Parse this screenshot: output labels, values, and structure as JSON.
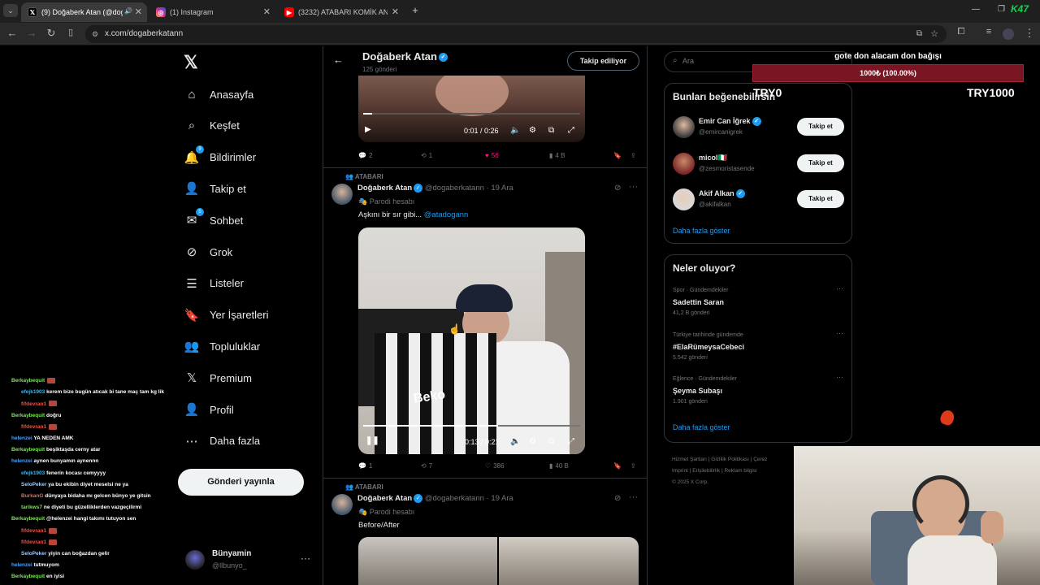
{
  "browser": {
    "tabs": [
      {
        "label": "(9) Doğaberk Atan (@dogaberkatann)",
        "icon": "x-logo-icon",
        "active": true
      },
      {
        "label": "(1) Instagram",
        "icon": "instagram-icon",
        "active": false
      },
      {
        "label": "(3232) ATABARI KOMİK ANLAR",
        "icon": "youtube-icon",
        "active": false
      }
    ],
    "url": "x.com/dogaberkatann"
  },
  "sidebar": {
    "items": [
      {
        "label": "Anasayfa",
        "icon": "home-icon"
      },
      {
        "label": "Keşfet",
        "icon": "search-icon"
      },
      {
        "label": "Bildirimler",
        "icon": "bell-icon",
        "badge": "9"
      },
      {
        "label": "Takip et",
        "icon": "add-person-icon"
      },
      {
        "label": "Sohbet",
        "icon": "chat-icon",
        "badge": "5"
      },
      {
        "label": "Grok",
        "icon": "grok-icon"
      },
      {
        "label": "Listeler",
        "icon": "list-icon"
      },
      {
        "label": "Yer İşaretleri",
        "icon": "bookmark-icon"
      },
      {
        "label": "Topluluklar",
        "icon": "communities-icon"
      },
      {
        "label": "Premium",
        "icon": "x-premium-icon"
      },
      {
        "label": "Profil",
        "icon": "person-icon"
      },
      {
        "label": "Daha fazla",
        "icon": "more-circle-icon"
      }
    ],
    "post_button": "Gönderi yayınla",
    "account": {
      "name": "Bünyamin",
      "handle": "@llbunyo_"
    }
  },
  "profile_header": {
    "name": "Doğaberk Atan",
    "posts": "125 gönderi",
    "follow_label": "Takip ediliyor"
  },
  "tweets": [
    {
      "video_time": "0:01 / 0:26",
      "video_progress": 0.04,
      "replies": "2",
      "reposts": "1",
      "likes": "56",
      "views": "4 B",
      "liked": true
    },
    {
      "community": "ATABARI",
      "name": "Doğaberk Atan",
      "handle": "@dogaberkatann",
      "date": "19 Ara",
      "label": "Parodi hesabı",
      "text": "Aşkını bir sır gibi...",
      "mention": "@atadogann",
      "video_time": "0:13 / 0:21",
      "video_progress": 0.62,
      "video_jersey_text": "Beko",
      "replies": "1",
      "reposts": "7",
      "likes": "386",
      "views": "40 B"
    },
    {
      "community": "ATABARI",
      "name": "Doğaberk Atan",
      "handle": "@dogaberkatann",
      "date": "19 Ara",
      "label": "Parodi hesabı",
      "text": "Before/After"
    }
  ],
  "search": {
    "placeholder": "Ara"
  },
  "suggestions": {
    "title": "Bunları beğenebilirsin",
    "users": [
      {
        "name": "Emir Can İğrek",
        "handle": "@emircanigrek",
        "button": "Takip et",
        "verified": true
      },
      {
        "name": "micol🇮🇹",
        "handle": "@zesmoristasende",
        "button": "Takip et",
        "verified": false
      },
      {
        "name": "Akif Alkan",
        "handle": "@akifalkan",
        "button": "Takip et",
        "verified": true
      }
    ],
    "more": "Daha fazla göster"
  },
  "trends": {
    "title": "Neler oluyor?",
    "items": [
      {
        "category": "Spor · Gündemdekiler",
        "name": "Sadettin Saran",
        "count": "41,2 B gönderi"
      },
      {
        "category": "Türkiye tarihinde gündemde",
        "name": "#ElaRümeysaCebeci",
        "count": "5.542 gönderi"
      },
      {
        "category": "Eğlence · Gündemdekiler",
        "name": "Şeyma Subaşı",
        "count": "1.901 gönderi"
      }
    ],
    "more": "Daha fazla göster"
  },
  "footer": {
    "links": [
      "Hizmet Şartları",
      "Gizlilik Politikası",
      "Çerez",
      "Imprint",
      "Erişilebilirlik",
      "Reklam bilgisi"
    ],
    "copyright": "© 2025 X Corp."
  },
  "overlay": {
    "donation_title": "gote don alacam don bağışı",
    "donation_bar": "1000₺ (100.00%)",
    "donation_progress": 1.0,
    "left_amount": "TRY0",
    "right_amount": "TRY1000",
    "logo_text": "K47"
  },
  "chat": [
    {
      "user": "Berkaybequit",
      "color": "#7fe35a",
      "msg": "",
      "emote": true
    },
    {
      "user": "efejk1903",
      "color": "#3fb5e8",
      "msg": "kerem bize bugün atıcak bi tane maç tam kg lik",
      "emote": false
    },
    {
      "user": "fifdevran1",
      "color": "#e0564a",
      "msg": "",
      "emote": true
    },
    {
      "user": "Berkaybequit",
      "color": "#7fe35a",
      "msg": "doğru",
      "emote": false
    },
    {
      "user": "fifdevran1",
      "color": "#e0564a",
      "msg": "",
      "emote": true
    },
    {
      "user": "helenzei",
      "color": "#4aa3ff",
      "msg": "YA NEDEN AMK",
      "emote": false
    },
    {
      "user": "Berkaybequit",
      "color": "#7fe35a",
      "msg": "beşiktaşda cerny atar",
      "emote": false
    },
    {
      "user": "helenzei",
      "color": "#4aa3ff",
      "msg": "aynen bunyamın aynennn",
      "emote": false
    },
    {
      "user": "efejk1903",
      "color": "#3fb5e8",
      "msg": "fenerin kocası cemyyyy",
      "emote": false
    },
    {
      "user": "SeloPeker",
      "color": "#9ecbff",
      "msg": "ya bu ekibin diyet meselsi ne ya",
      "emote": false
    },
    {
      "user": "BurkanG",
      "color": "#e06b5a",
      "msg": "dünyaya bidaha mı gelcen bünyo ye gitsin",
      "emote": false
    },
    {
      "user": "tarikws7",
      "color": "#7fe35a",
      "msg": "ne diyeti bu güzelliklerden vazgeçilirmi",
      "emote": false
    },
    {
      "user": "Berkaybequit",
      "color": "#7fe35a",
      "msg": "@helenzei hangi takımı tutuyon sen",
      "emote": false
    },
    {
      "user": "fifdevran1",
      "color": "#e0564a",
      "msg": "",
      "emote": true
    },
    {
      "user": "fifdevran1",
      "color": "#e0564a",
      "msg": "",
      "emote": true
    },
    {
      "user": "SeloPeker",
      "color": "#9ecbff",
      "msg": "yiyin can boğazdan gelir",
      "emote": false
    },
    {
      "user": "helenzei",
      "color": "#4aa3ff",
      "msg": "tutmuyom",
      "emote": false
    },
    {
      "user": "Berkaybequit",
      "color": "#7fe35a",
      "msg": "en iyisi",
      "emote": false
    }
  ],
  "colors": {
    "accent": "#1d9bf0",
    "like": "#f91880",
    "donation": "#7a1524"
  }
}
